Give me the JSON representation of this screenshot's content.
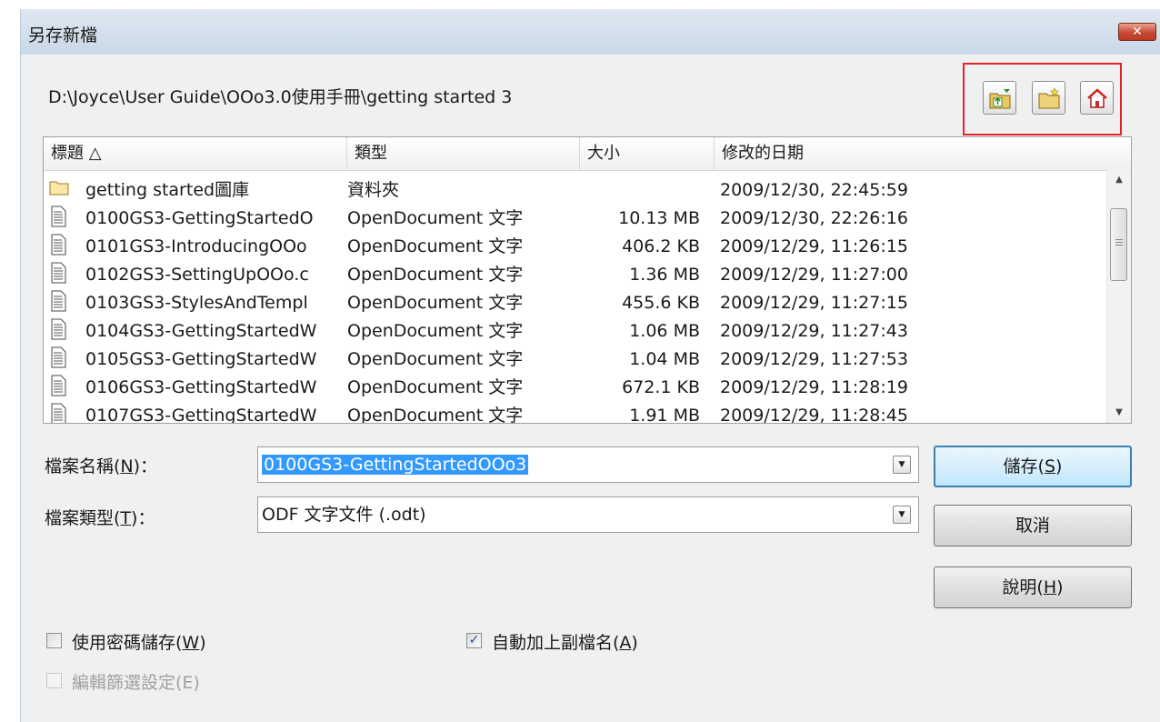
{
  "dialog": {
    "title": "另存新檔",
    "close_label": "✕"
  },
  "path": "D:\\Joyce\\User Guide\\OOo3.0使用手冊\\getting started 3",
  "toolbar_icons": [
    "folder-up-icon",
    "new-folder-icon",
    "home-icon"
  ],
  "columns": {
    "name": "標題 △",
    "type": "類型",
    "size": "大小",
    "modified": "修改的日期"
  },
  "files": [
    {
      "icon": "folder-icon",
      "name": "getting started圖庫",
      "type": "資料夾",
      "size": "",
      "modified": "2009/12/30, 22:45:59"
    },
    {
      "icon": "document-icon",
      "name": "0100GS3-GettingStartedO",
      "type": "OpenDocument 文字",
      "size": "10.13 MB",
      "modified": "2009/12/30, 22:26:16"
    },
    {
      "icon": "document-icon",
      "name": "0101GS3-IntroducingOOo",
      "type": "OpenDocument 文字",
      "size": "406.2 KB",
      "modified": "2009/12/29, 11:26:15"
    },
    {
      "icon": "document-icon",
      "name": "0102GS3-SettingUpOOo.c",
      "type": "OpenDocument 文字",
      "size": "1.36 MB",
      "modified": "2009/12/29, 11:27:00"
    },
    {
      "icon": "document-icon",
      "name": "0103GS3-StylesAndTempl",
      "type": "OpenDocument 文字",
      "size": "455.6 KB",
      "modified": "2009/12/29, 11:27:15"
    },
    {
      "icon": "document-icon",
      "name": "0104GS3-GettingStartedW",
      "type": "OpenDocument 文字",
      "size": "1.06 MB",
      "modified": "2009/12/29, 11:27:43"
    },
    {
      "icon": "document-icon",
      "name": "0105GS3-GettingStartedW",
      "type": "OpenDocument 文字",
      "size": "1.04 MB",
      "modified": "2009/12/29, 11:27:53"
    },
    {
      "icon": "document-icon",
      "name": "0106GS3-GettingStartedW",
      "type": "OpenDocument 文字",
      "size": "672.1 KB",
      "modified": "2009/12/29, 11:28:19"
    },
    {
      "icon": "document-icon",
      "name": "0107GS3-GettingStartedW",
      "type": "OpenDocument 文字",
      "size": "1.91 MB",
      "modified": "2009/12/29, 11:28:45"
    }
  ],
  "filename": {
    "label_pre": "檔案名稱(",
    "label_key": "N",
    "label_post": ")：",
    "value": "0100GS3-GettingStartedOOo3"
  },
  "filetype": {
    "label_pre": "檔案類型(",
    "label_key": "T",
    "label_post": ")：",
    "value": "ODF 文字文件 (.odt)"
  },
  "buttons": {
    "save_pre": "儲存(",
    "save_key": "S",
    "save_post": ")",
    "cancel": "取消",
    "help_pre": "說明(",
    "help_key": "H",
    "help_post": ")"
  },
  "options": {
    "password_pre": "使用密碼儲存(",
    "password_key": "W",
    "password_post": ")",
    "password_checked": false,
    "autoext_pre": "自動加上副檔名(",
    "autoext_key": "A",
    "autoext_post": ")",
    "autoext_checked": true,
    "filter_label": "編輯篩選設定(E)",
    "filter_checked": false,
    "filter_enabled": false
  },
  "colors": {
    "highlight_border": "#e0262c",
    "selection": "#3399ff",
    "default_button_border": "#3c7fb1"
  }
}
